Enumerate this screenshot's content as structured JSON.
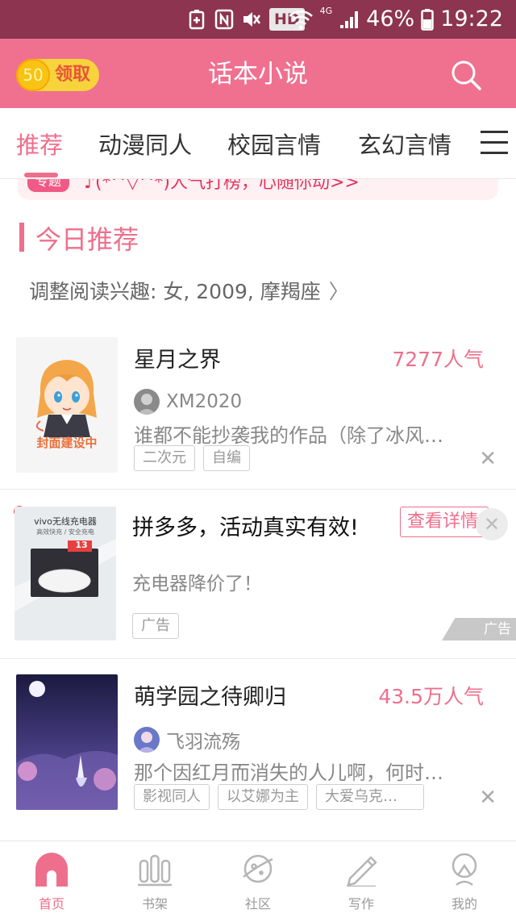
{
  "status_bar": {
    "battery": "46%",
    "time": "19:22",
    "hd": "HD",
    "network": "4G"
  },
  "header": {
    "coin_count": "50",
    "coin_label": "领取",
    "title": "话本小说"
  },
  "tabs": [
    "推荐",
    "动漫同人",
    "校园言情",
    "玄幻言情"
  ],
  "banner": {
    "tag": "专题",
    "text": "♪(*^▽^*)人气打榜，心随你动>>"
  },
  "section": {
    "title": "今日推荐",
    "interest_text": "调整阅读兴趣: 女, 2009, 摩羯座"
  },
  "books": [
    {
      "title": "星月之界",
      "popularity": "7277人气",
      "author": "XM2020",
      "description": "谁都不能抄袭我的作品（除了冰风…",
      "tags": [
        "二次元",
        "自编"
      ],
      "cover_text": "封面建设中"
    },
    {
      "title": "萌学园之待卿归",
      "popularity": "43.5万人气",
      "author": "飞羽流殇",
      "description": "那个因红月而消失的人儿啊，何时…",
      "tags": [
        "影视同人",
        "以艾娜为主",
        "大爱乌克…"
      ]
    }
  ],
  "ad": {
    "title": "拼多多，活动真实有效!",
    "subtitle": "充电器降价了！",
    "cta": "查看详情",
    "tag": "广告",
    "mark": "广告",
    "image_text_1": "vivo无线充电器",
    "image_text_2": "高效快充 / 安全充电",
    "image_price": "13"
  },
  "bottom_nav": [
    {
      "label": "首页",
      "icon": "home-icon"
    },
    {
      "label": "书架",
      "icon": "bookshelf-icon"
    },
    {
      "label": "社区",
      "icon": "community-planet-icon"
    },
    {
      "label": "写作",
      "icon": "pencil-icon"
    },
    {
      "label": "我的",
      "icon": "profile-icon"
    }
  ],
  "colors": {
    "brand_pink": "#f07090",
    "accent_pink": "#ee6f8c",
    "status_bar": "#8c3450",
    "coin_gold": "#f9c313"
  }
}
